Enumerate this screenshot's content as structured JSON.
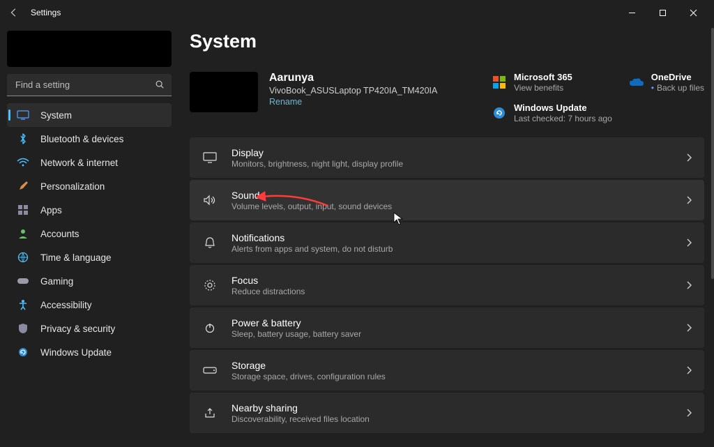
{
  "window": {
    "title": "Settings"
  },
  "search": {
    "placeholder": "Find a setting"
  },
  "nav": {
    "items": [
      {
        "label": "System"
      },
      {
        "label": "Bluetooth & devices"
      },
      {
        "label": "Network & internet"
      },
      {
        "label": "Personalization"
      },
      {
        "label": "Apps"
      },
      {
        "label": "Accounts"
      },
      {
        "label": "Time & language"
      },
      {
        "label": "Gaming"
      },
      {
        "label": "Accessibility"
      },
      {
        "label": "Privacy & security"
      },
      {
        "label": "Windows Update"
      }
    ]
  },
  "page": {
    "title": "System"
  },
  "device": {
    "username": "Aarunya",
    "name": "VivoBook_ASUSLaptop TP420IA_TM420IA",
    "rename": "Rename"
  },
  "cards": {
    "ms365": {
      "title": "Microsoft 365",
      "subtitle": "View benefits"
    },
    "onedrive": {
      "title": "OneDrive",
      "subtitle": "Back up files"
    },
    "update": {
      "title": "Windows Update",
      "subtitle": "Last checked: 7 hours ago"
    }
  },
  "settings": [
    {
      "title": "Display",
      "desc": "Monitors, brightness, night light, display profile"
    },
    {
      "title": "Sound",
      "desc": "Volume levels, output, input, sound devices"
    },
    {
      "title": "Notifications",
      "desc": "Alerts from apps and system, do not disturb"
    },
    {
      "title": "Focus",
      "desc": "Reduce distractions"
    },
    {
      "title": "Power & battery",
      "desc": "Sleep, battery usage, battery saver"
    },
    {
      "title": "Storage",
      "desc": "Storage space, drives, configuration rules"
    },
    {
      "title": "Nearby sharing",
      "desc": "Discoverability, received files location"
    }
  ]
}
